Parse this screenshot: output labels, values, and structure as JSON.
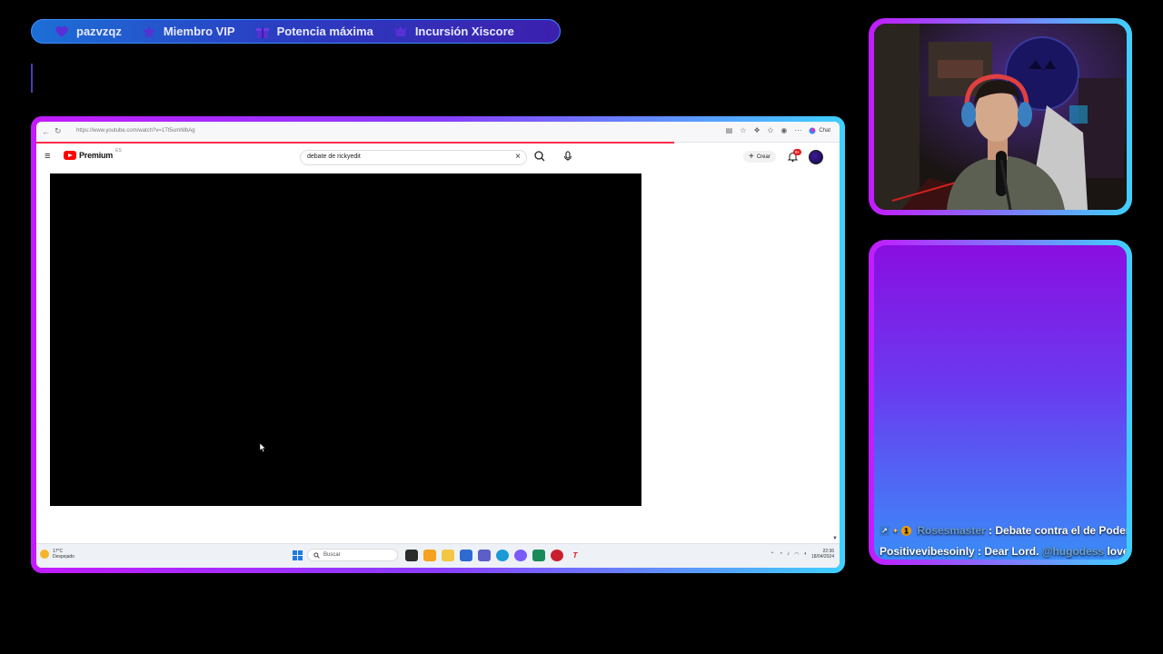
{
  "alerts": {
    "items": [
      {
        "icon": "heart-icon",
        "label": "pazvzqz"
      },
      {
        "icon": "star-icon",
        "label": "Miembro VIP"
      },
      {
        "icon": "gift-icon",
        "label": "Potencia máxima"
      },
      {
        "icon": "raid-icon",
        "label": "Incursión Xiscore"
      }
    ]
  },
  "browser": {
    "url": "https://www.youtube.com/watch?v=1Tt5umNlbAg",
    "chat_label": "Chat"
  },
  "youtube": {
    "logo_text": "Premium",
    "logo_sup": "ES",
    "search_value": "debate de rickyedit",
    "create_label": "Crear",
    "notif_badge": "9+"
  },
  "taskbar": {
    "weather_temp": "17°C",
    "weather_desc": "Despejado",
    "search_placeholder": "Buscar",
    "time": "22:36",
    "date": "18/04/2024"
  },
  "chat": {
    "messages": [
      {
        "user": "Rosesmaster",
        "sep": " : ",
        "text": "Debate contra el de Poden"
      },
      {
        "user": "Positivevibesoinly",
        "sep": " : ",
        "text": "Dear Lord. ",
        "mention": "@hugodess",
        "after": " loves"
      }
    ]
  },
  "colors": {
    "frame_gradient_start": "#c21bff",
    "frame_gradient_end": "#3fd0ff",
    "alert_bar": "#2a3fc2"
  }
}
